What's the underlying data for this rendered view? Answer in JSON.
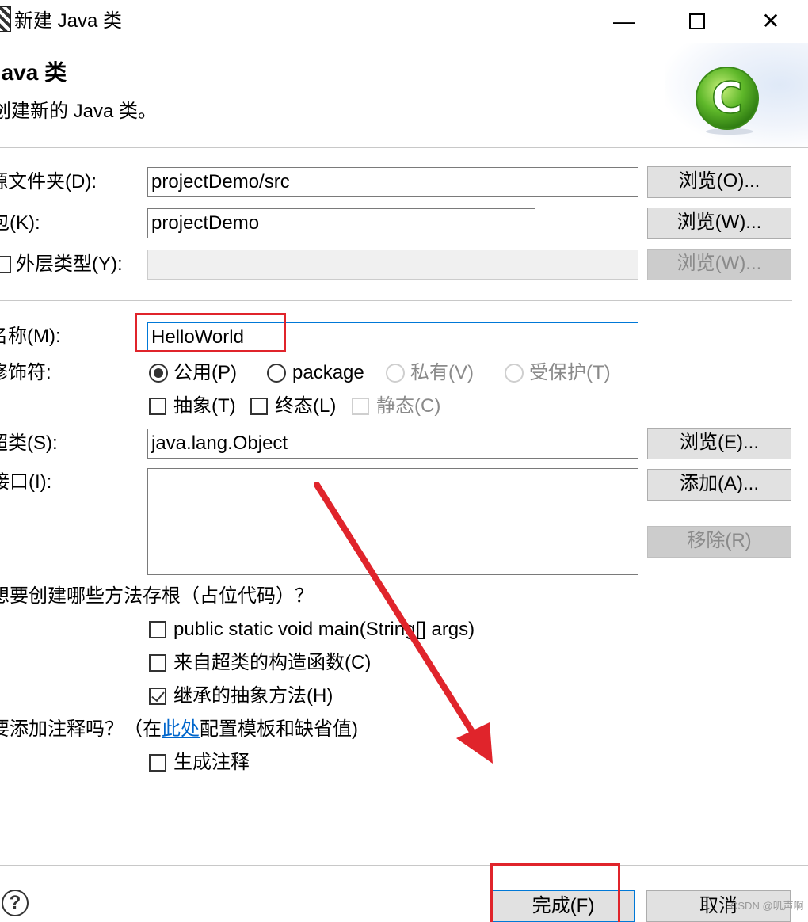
{
  "window": {
    "title": "新建 Java 类",
    "minimize_icon": "minimize-icon",
    "maximize_icon": "maximize-icon",
    "close_icon": "close-icon"
  },
  "banner": {
    "heading": "Java 类",
    "description": "创建新的 Java 类。",
    "icon": "java-class-wizard-icon"
  },
  "form": {
    "source_folder": {
      "label": "源文件夹(D):",
      "value": "projectDemo/src",
      "browse": "浏览(O)..."
    },
    "package": {
      "label": "包(K):",
      "value": "projectDemo",
      "browse": "浏览(W)..."
    },
    "enclosing_type": {
      "label": "外层类型(Y):",
      "checked": false,
      "value": "",
      "browse": "浏览(W)..."
    },
    "name": {
      "label": "名称(M):",
      "value": "HelloWorld"
    },
    "modifiers": {
      "label": "修饰符:",
      "radios": [
        {
          "label": "公用(P)",
          "checked": true,
          "enabled": true
        },
        {
          "label": "package",
          "checked": false,
          "enabled": true
        },
        {
          "label": "私有(V)",
          "checked": false,
          "enabled": false
        },
        {
          "label": "受保护(T)",
          "checked": false,
          "enabled": false
        }
      ],
      "checkboxes": [
        {
          "label": "抽象(T)",
          "checked": false,
          "enabled": true
        },
        {
          "label": "终态(L)",
          "checked": false,
          "enabled": true
        },
        {
          "label": "静态(C)",
          "checked": false,
          "enabled": false
        }
      ]
    },
    "superclass": {
      "label": "超类(S):",
      "value": "java.lang.Object",
      "browse": "浏览(E)..."
    },
    "interfaces": {
      "label": "接口(I):",
      "add": "添加(A)...",
      "remove": "移除(R)"
    },
    "method_stubs": {
      "question": "想要创建哪些方法存根（占位代码）？",
      "options": [
        {
          "label": "public static void main(String[] args)",
          "checked": false
        },
        {
          "label": "来自超类的构造函数(C)",
          "checked": false
        },
        {
          "label": "继承的抽象方法(H)",
          "checked": true
        }
      ]
    },
    "comments": {
      "question_prefix": "要添加注释吗？（在",
      "link": "此处",
      "question_suffix": "配置模板和缺省值)",
      "option": {
        "label": "生成注释",
        "checked": false
      }
    }
  },
  "footer": {
    "help_icon": "help-icon",
    "finish": "完成(F)",
    "cancel": "取消"
  },
  "watermark": "CSDN @叽声啊",
  "annotation_colors": {
    "red": "#e0242b",
    "focus": "#0078d7"
  }
}
